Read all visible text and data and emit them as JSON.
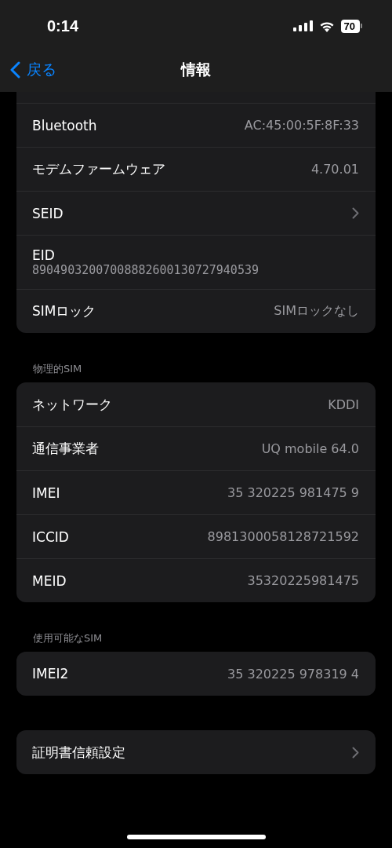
{
  "status_bar": {
    "time": "0:14",
    "battery": "70"
  },
  "nav": {
    "back": "戻る",
    "title": "情報"
  },
  "sections": [
    {
      "rows": [
        {
          "kind": "value",
          "label": "Bluetooth",
          "value": "AC:45:00:5F:8F:33"
        },
        {
          "kind": "value",
          "label": "モデムファームウェア",
          "value": "4.70.01"
        },
        {
          "kind": "chevron",
          "label": "SEID"
        },
        {
          "kind": "stacked",
          "label": "EID",
          "value": "89049032007008882600130727940539"
        },
        {
          "kind": "value",
          "label": "SIMロック",
          "value": "SIMロックなし"
        }
      ]
    },
    {
      "header": "物理的SIM",
      "rows": [
        {
          "kind": "value",
          "label": "ネットワーク",
          "value": "KDDI"
        },
        {
          "kind": "value",
          "label": "通信事業者",
          "value": "UQ mobile 64.0"
        },
        {
          "kind": "value",
          "label": "IMEI",
          "value": "35 320225 981475 9"
        },
        {
          "kind": "value",
          "label": "ICCID",
          "value": "8981300058128721592"
        },
        {
          "kind": "value",
          "label": "MEID",
          "value": "35320225981475"
        }
      ]
    },
    {
      "header": "使用可能なSIM",
      "rows": [
        {
          "kind": "value",
          "label": "IMEI2",
          "value": "35 320225 978319 4"
        }
      ]
    },
    {
      "rows": [
        {
          "kind": "chevron",
          "label": "証明書信頼設定"
        }
      ]
    }
  ]
}
